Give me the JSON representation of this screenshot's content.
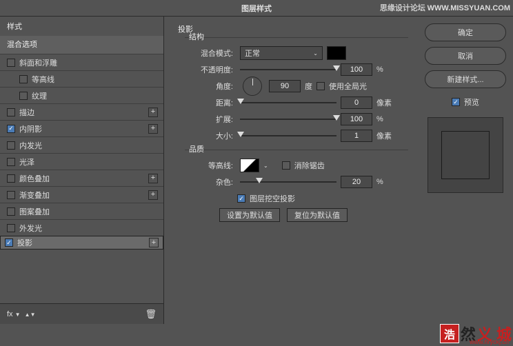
{
  "title": "图层样式",
  "watermark_top": {
    "cn": "思缘设计论坛",
    "url": "WWW.MISSYUAN.COM"
  },
  "left": {
    "header": "样式",
    "blend": "混合选项",
    "items": [
      {
        "label": "斜面和浮雕",
        "checked": false,
        "plus": false,
        "indent": 0,
        "sel": false
      },
      {
        "label": "等高线",
        "checked": false,
        "plus": false,
        "indent": 1,
        "sel": false
      },
      {
        "label": "纹理",
        "checked": false,
        "plus": false,
        "indent": 1,
        "sel": false
      },
      {
        "label": "描边",
        "checked": false,
        "plus": true,
        "indent": 0,
        "sel": false
      },
      {
        "label": "内阴影",
        "checked": true,
        "plus": true,
        "indent": 0,
        "sel": false
      },
      {
        "label": "内发光",
        "checked": false,
        "plus": false,
        "indent": 0,
        "sel": false
      },
      {
        "label": "光泽",
        "checked": false,
        "plus": false,
        "indent": 0,
        "sel": false
      },
      {
        "label": "颜色叠加",
        "checked": false,
        "plus": true,
        "indent": 0,
        "sel": false
      },
      {
        "label": "渐变叠加",
        "checked": false,
        "plus": true,
        "indent": 0,
        "sel": false
      },
      {
        "label": "图案叠加",
        "checked": false,
        "plus": false,
        "indent": 0,
        "sel": false
      },
      {
        "label": "外发光",
        "checked": false,
        "plus": false,
        "indent": 0,
        "sel": false
      },
      {
        "label": "投影",
        "checked": true,
        "plus": true,
        "indent": 0,
        "sel": true
      }
    ],
    "fx": "fx"
  },
  "mid": {
    "title": "投影",
    "structure": "结构",
    "blend_mode_label": "混合模式:",
    "blend_mode_value": "正常",
    "opacity_label": "不透明度:",
    "opacity_value": "100",
    "pct": "%",
    "angle_label": "角度:",
    "angle_value": "90",
    "deg": "度",
    "global_label": "使用全局光",
    "distance_label": "距离:",
    "distance_value": "0",
    "px": "像素",
    "spread_label": "扩展:",
    "spread_value": "100",
    "size_label": "大小:",
    "size_value": "1",
    "quality": "品质",
    "contour_label": "等高线:",
    "aa_label": "消除锯齿",
    "noise_label": "杂色:",
    "noise_value": "20",
    "knockout_label": "图层挖空投影",
    "btn_default": "设置为默认值",
    "btn_reset": "复位为默认值"
  },
  "right": {
    "ok": "确定",
    "cancel": "取消",
    "newstyle": "新建样式...",
    "preview": "预览"
  },
  "wm_br": {
    "box": "浩",
    "t1": "然",
    "t2": "义 城",
    "url": "www.hryckj.cn"
  }
}
